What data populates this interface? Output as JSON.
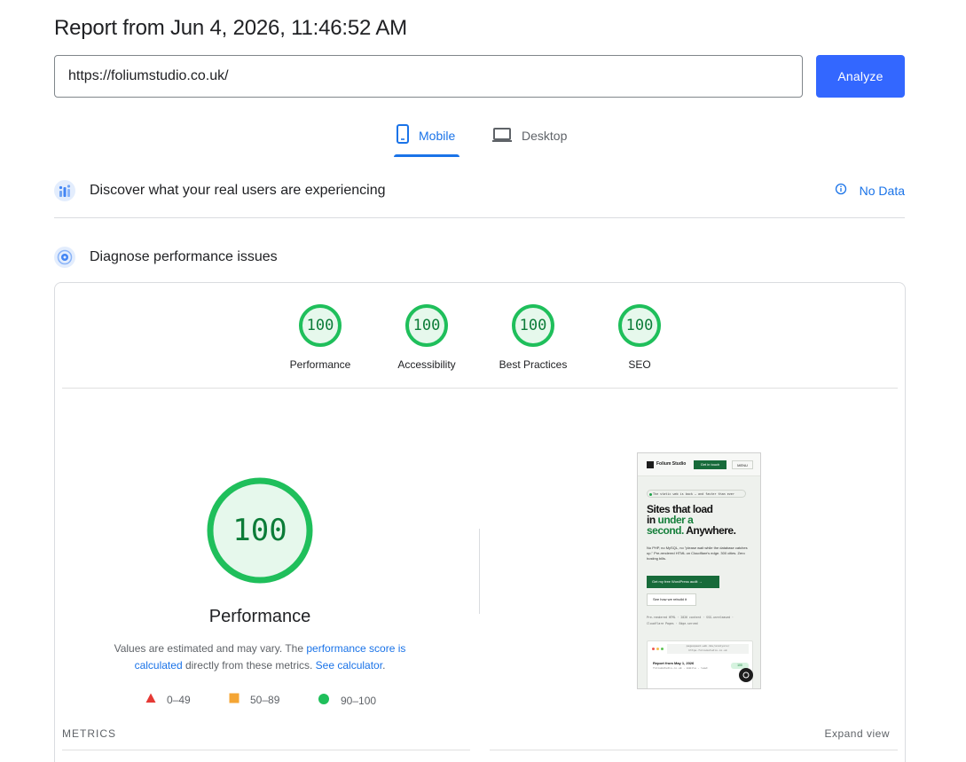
{
  "header": {
    "title": "Report from Jun 4, 2026, 11:46:52 AM"
  },
  "search": {
    "url_value": "https://foliumstudio.co.uk/",
    "analyze_label": "Analyze"
  },
  "tabs": [
    {
      "label": "Mobile",
      "icon": "phone-icon",
      "selected": true
    },
    {
      "label": "Desktop",
      "icon": "laptop-icon",
      "selected": false
    }
  ],
  "field_data": {
    "title": "Discover what your real users are experiencing",
    "status": "No Data",
    "icon": "users-chart-icon"
  },
  "lab_data": {
    "title": "Diagnose performance issues",
    "icon": "target-icon"
  },
  "categories": [
    {
      "label": "Performance",
      "score": "100"
    },
    {
      "label": "Accessibility",
      "score": "100"
    },
    {
      "label": "Best Practices",
      "score": "100"
    },
    {
      "label": "SEO",
      "score": "100"
    }
  ],
  "performance": {
    "score": "100",
    "title": "Performance",
    "desc_prefix": "Values are estimated and may vary. The ",
    "desc_link1": "performance score is calculated",
    "desc_middle": " directly from these metrics. ",
    "desc_link2": "See calculator",
    "desc_suffix": "."
  },
  "legend": [
    {
      "range": "0–49",
      "color": "#e53935",
      "shape": "triangle"
    },
    {
      "range": "50–89",
      "color": "#f4a534",
      "shape": "square"
    },
    {
      "range": "90–100",
      "color": "#1fbf5b",
      "shape": "circle"
    }
  ],
  "metrics": {
    "label": "METRICS",
    "expand_label": "Expand view"
  },
  "colors": {
    "accent": "#1a73e8",
    "button": "#3367ff",
    "pass_green": "#1fbf5b",
    "pass_fill": "#e6f8ec",
    "score_text": "#0c7c38"
  },
  "thumbnail": {
    "brand": "Folium Studio",
    "cta": "Get in touch",
    "menu": "MENU",
    "pill": "The static web is back — and faster than ever",
    "hero_line1": "Sites that load",
    "hero_line2_a": "in ",
    "hero_line2_b": "under a",
    "hero_line3_a": "second.",
    "hero_line3_b": " Anywhere.",
    "body": "No PHP, no MySQL, no \"please wait while the database catches up.\" Pre-rendered HTML on Cloudflare's edge. 300 cities. Zero hosting bills.",
    "btn1": "Get my free WordPress audit →",
    "btn2": "See how we rebuild it",
    "meta1": "Pre-rendered HTML · 2026 content · SSG-unreleased ·",
    "meta2": "Cloudflare Pages · Edge-served",
    "url_bar1": "pagespeed.web.dev/analysis/",
    "url_bar2": "https-foliumstudio-co-uk",
    "report_title": "Report from May 1, 2026",
    "report_sub": "foliumstudio.co.uk · mobile · lead",
    "pass_label": "100"
  }
}
